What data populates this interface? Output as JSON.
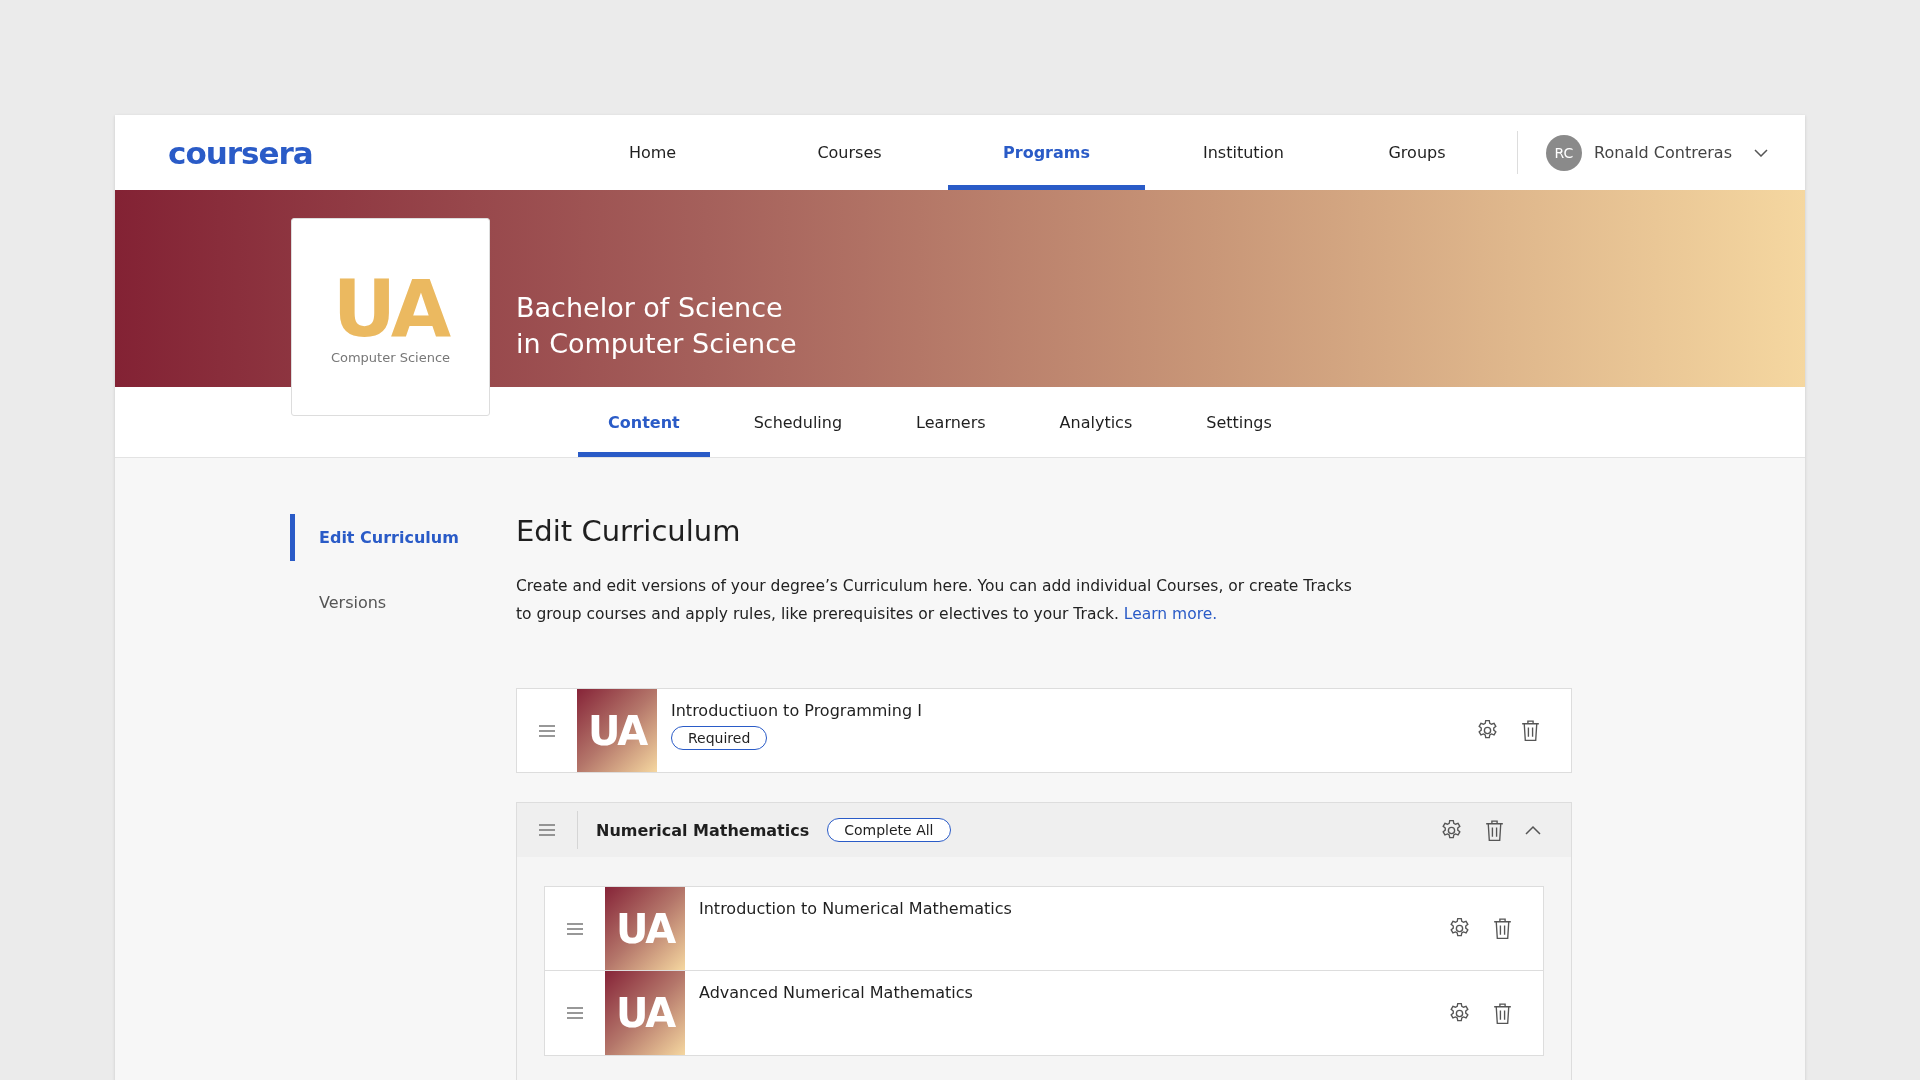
{
  "header": {
    "logo": "coursera",
    "nav": [
      {
        "label": "Home",
        "selected": false
      },
      {
        "label": "Courses",
        "selected": false
      },
      {
        "label": "Programs",
        "selected": true
      },
      {
        "label": "Institution",
        "selected": false
      },
      {
        "label": "Groups",
        "selected": false
      }
    ],
    "user": {
      "initials": "RC",
      "name": "Ronald Contreras"
    }
  },
  "banner": {
    "logo_mark": "UA",
    "logo_caption": "Computer Science",
    "title_lines": [
      "Bachelor of Science",
      "in Computer Science"
    ]
  },
  "tabs": [
    {
      "label": "Content",
      "selected": true
    },
    {
      "label": "Scheduling",
      "selected": false
    },
    {
      "label": "Learners",
      "selected": false
    },
    {
      "label": "Analytics",
      "selected": false
    },
    {
      "label": "Settings",
      "selected": false
    }
  ],
  "sidebar": {
    "items": [
      {
        "label": "Edit Curriculum",
        "selected": true
      },
      {
        "label": "Versions",
        "selected": false
      }
    ]
  },
  "main": {
    "title": "Edit Curriculum",
    "description": "Create and edit versions of your degree’s Curriculum here. You can add individual Courses, or create Tracks to group courses and apply rules, like prerequisites or electives to your Track.",
    "link": "Learn more.",
    "items": [
      {
        "kind": "course",
        "thumb": "UA",
        "title": "Introductiuon to Programming I",
        "tag": "Required"
      },
      {
        "kind": "track",
        "title": "Numerical Mathematics",
        "tag": "Complete All",
        "expanded": true,
        "children": [
          {
            "kind": "course",
            "thumb": "UA",
            "title": "Introduction to Numerical Mathematics"
          },
          {
            "kind": "course",
            "thumb": "UA",
            "title": "Advanced Numerical Mathematics"
          }
        ]
      }
    ]
  }
}
